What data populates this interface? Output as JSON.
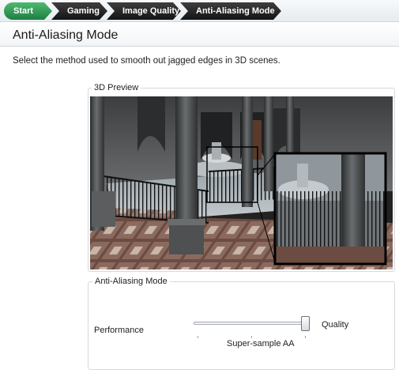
{
  "breadcrumb": {
    "items": [
      {
        "label": "Start",
        "active": true
      },
      {
        "label": "Gaming",
        "active": false
      },
      {
        "label": "Image Quality",
        "active": false
      },
      {
        "label": "Anti-Aliasing Mode",
        "active": false
      }
    ]
  },
  "page": {
    "title": "Anti-Aliasing Mode",
    "description": "Select the method used to smooth out jagged edges in 3D scenes."
  },
  "preview": {
    "group_label": "3D Preview"
  },
  "aa_mode": {
    "group_label": "Anti-Aliasing Mode",
    "min_label": "Performance",
    "max_label": "Quality",
    "selected_value": "Super-sample AA",
    "slider_position": 1.0
  },
  "colors": {
    "breadcrumb_active": "#2e9a55",
    "breadcrumb_inactive": "#262626"
  }
}
